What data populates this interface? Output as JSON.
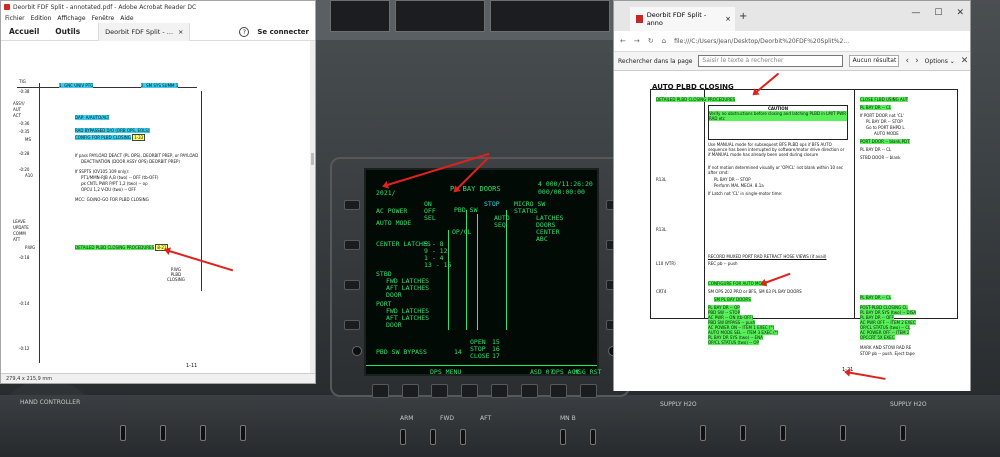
{
  "acrobat": {
    "title": "Deorbit FDF Split - annotated.pdf - Adobe Acrobat Reader DC",
    "menu": [
      "Fichier",
      "Edition",
      "Affichage",
      "Fenêtre",
      "Aide"
    ],
    "nav_tabs": [
      "Accueil",
      "Outils"
    ],
    "doc_tab": "Deorbit FDF Split - ...",
    "sign_in": "Se connecter",
    "help_glyph": "?",
    "page_size": "279,4 x 215,9 mm",
    "page_number": "1-11",
    "doc": {
      "header_items": [
        "1. GNC UNIV PTG",
        "2. SM SYS SUMM 1"
      ],
      "left_labels": [
        "TIG",
        "-0:38",
        "ASSY/",
        "AUT",
        "ACT",
        "-0:36",
        "-0:35",
        "-0:28",
        "-0:20",
        "MS",
        "A10",
        "LEAVE",
        "UPDATE",
        "COMM",
        "ATT",
        "P.WG",
        "-0:18",
        "-0:14",
        "-0:12"
      ],
      "lines": {
        "dap": "DAP: A/AUTO/ALT",
        "rad": "RAD BYPASSED D/O (ORB OPS, EOLS)",
        "config": "CONFIG FOR PLBD CLOSING",
        "config_ref": "1-33",
        "pass1": "If pass PAYLOAD DEACT (PL OPS), DEORBIT PREP, or PAYLOAD",
        "pass2": "DEACTIVATION (DOOR ASSY OPS) DEORBIT PREP)",
        "sspts1": "If SSPTS (OV105 109 only):",
        "sspts2": "PT1/MMN-RJB A,B (two) -- OFF (tb-OFF)",
        "sspts3": "pk CNTL PWR P/PT 1,2 (two) -- op",
        "sspts4": "OPCU 1,2 V-DU (two) -- OFF",
        "mcc": "MCC: GO/NO-GO FOR PLBD CLOSING",
        "detailed": "DETAILED PLBD CLOSING PROCEDURES",
        "detailed_ref": "8-21",
        "stamp": "P.WG\nPLBD\nCLOSING"
      }
    }
  },
  "mdu": {
    "title": "PL BAY DOORS",
    "id": "2021/",
    "time": "4 000/11:26:20",
    "time2": "000/00:00:00",
    "ac_power": "AC POWER",
    "on": "ON",
    "off": "OFF",
    "sel": "SEL",
    "auto_mode": "AUTO MODE",
    "op_cl": "OP/CL",
    "pbd_sw": "PBD SW",
    "stop": "STOP",
    "micro_sw": "MICRO SW",
    "status": "STATUS",
    "auto": "AUTO",
    "seq": "SEQ",
    "latches": [
      "LATCHES",
      "DOORS",
      "CENTER",
      "ABC"
    ],
    "center_latches": "CENTER LATCHES",
    "c_rows": [
      "5 - 8",
      "9 - 12",
      "1 - 4",
      "13 - 16"
    ],
    "stbd": "STBD",
    "fwd_latches": "FWD LATCHES",
    "aft_latches": "AFT LATCHES",
    "door": "DOOR",
    "port": "PORT",
    "pbd_sw_bypass": "PBD SW BYPASS",
    "open": "OPEN",
    "stop2": "STOP",
    "close": "CLOSE",
    "open_n": "15",
    "stop_n": "16",
    "close_n": "17",
    "bypass_n": "14",
    "softkeys": [
      "DPS MENU",
      "ASD 0?",
      "DPS ACK",
      "MSG RST"
    ]
  },
  "edge": {
    "tab_title": "Deorbit FDF Split - anno",
    "url": "file:///C:/Users/Jean/Desktop/Deorbit%20FDF%20Split%2...",
    "find_label": "Rechercher dans la page",
    "find_placeholder": "Saisir le texte à rechercher",
    "find_result": "Aucun résultat",
    "options": "Options",
    "page_number": "1-21",
    "doc": {
      "heading": "AUTO PLBD CLOSING",
      "proc": "DETAILED PLBD CLOSING PROCEDURES",
      "caution": "CAUTION",
      "caution_text": "Verify no obstructions before closing and latching PLBD in LM/T PWR RAD etc",
      "use_manual": "Use MANUAL mode for subsequent BFS PLBD ops if BFS AUTO sequence has been interrupted by software/motor drive direction or if MANUAL mode has already been used during closure",
      "r13l_1": "R13L",
      "if_not": "If not motion determined visually or 'OP/CL' not blank within 10 sec after cmd:",
      "pl_bay_dr": "PL BAY DR -- STOP",
      "perform_mal": "Perform MAL MECH. 8.1a",
      "if_latch": "If Latch not 'CL' in single-motor time:",
      "r13l_2": "R13L",
      "record": "RECORD MUXED PORT RAD RETRACT HOSE VIEWS (if avail)",
      "l10": "L10 (VTR)",
      "rec_pb": "REC pb -- push",
      "configure": "CONFIGURE FOR AUTO MODE",
      "crt4": "CRT4",
      "sm_ops": "SM OPS 202 PRO or BFS, SM 63 PL BAY DOORS",
      "sm_pl": "SM PL BAY DOORS",
      "steps": [
        "PL BAY DR -- OP",
        "PBD SW -- STOP",
        "AC PWR -- ON (tb-OFF)",
        "PBD SW BYPASS -- push",
        "AC POWER ON -- ITEM 1 EXEC (*)",
        "AUTO MODE SEL -- ITEM 3 EXEC (*)",
        "PL BAY DR SYS (two) -- ENA",
        "OP/CL STATUS (two) -- OP"
      ],
      "right_heading": "CLOSE FLBD USING AUT",
      "right_steps": [
        "PL BAY DR -- CL",
        "If PORT DOOR not 'CL'",
        "PL BAY DR -- STOP",
        "Go to PORT BHPD L",
        "AUTO MODE",
        "PORT DOOR -- blank,PDT",
        "PL BAY DR -- CL",
        "STBD DOOR -- blank"
      ],
      "pl_bay_cl": "PL BAY DR -- CL",
      "post_header": "POST-PLBD CLOSING CL",
      "post_steps": [
        "PL BAY DR SYS (two) -- DISA",
        "PL BAY DR -- OFF",
        "AC PWR OFF -- ITEM 2 EXEC",
        "OP/CL STATUS (two) -- CL",
        "AC POWER OFF -- ITEM 2",
        "OPCCRT 5X EXEC"
      ],
      "end_line": "MARK AND STOW RAD RE",
      "stop_pb": "STOP pb -- push. Eject tape"
    }
  },
  "cockpit": {
    "lower_labels": [
      "HAND CONTROLLER",
      "SUPPLY H2O",
      "SUPPLY H2O",
      "MN B",
      "ARM",
      "FWD",
      "AFT"
    ]
  },
  "colors": {
    "highlight_green": "#58f058",
    "highlight_cyan": "#39d1f0",
    "annotation_red": "#e0221c",
    "mdu_green": "#2ee36a",
    "mdu_cyan": "#38d7ea"
  }
}
